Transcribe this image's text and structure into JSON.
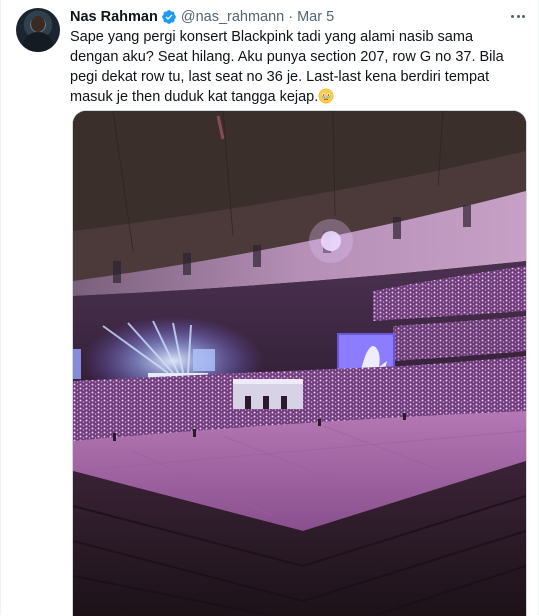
{
  "tweet": {
    "display_name": "Nas Rahman",
    "handle": "@nas_rahmann",
    "separator": "·",
    "date": "Mar 5",
    "text": "Sape yang pergi konsert Blackpink tadi yang alami nasib sama dengan aku? Seat hilang. Aku punya section 207, row G no 37. Bila pegi dekat row tu, last seat no 36 je. Last-last kena berdiri tempat masuk je then duduk kat tangga kejap.",
    "emoji": "face-holding-back-tears-icon"
  },
  "colors": {
    "verified_blue": "#1d9bf0",
    "secondary_text": "#536471",
    "primary_text": "#0f1419"
  }
}
